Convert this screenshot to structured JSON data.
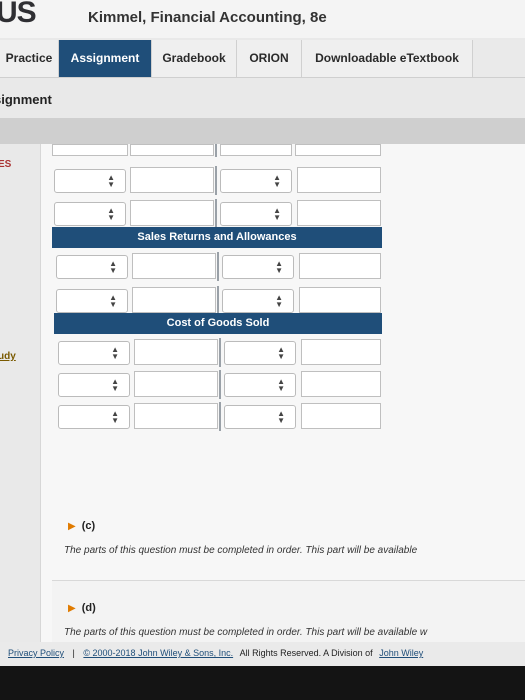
{
  "header": {
    "logo": "US",
    "book_title": "Kimmel, Financial Accounting, 8e"
  },
  "nav": {
    "tabs": [
      {
        "label": "Practice",
        "active": false
      },
      {
        "label": "Assignment",
        "active": true
      },
      {
        "label": "Gradebook",
        "active": false
      },
      {
        "label": "ORION",
        "active": false
      },
      {
        "label": "Downloadable eTextbook",
        "active": false
      }
    ]
  },
  "page": {
    "heading": "signment",
    "left_labels": [
      "ES",
      "udy"
    ]
  },
  "ledger": {
    "accounts": [
      {
        "title": "Sales Returns and Allowances"
      },
      {
        "title": "Cost of Goods Sold"
      }
    ]
  },
  "parts": [
    {
      "label": "(c)",
      "note": "The parts of this question must be completed in order. This part will be available"
    },
    {
      "label": "(d)",
      "note": "The parts of this question must be completed in order. This part will be available w"
    }
  ],
  "footer": {
    "privacy": "Privacy Policy",
    "separator": "|",
    "copyright_link": "© 2000-2018 John Wiley & Sons, Inc.",
    "rights_text": "All Rights Reserved. A Division of",
    "company_link": "John Wiley"
  },
  "colors": {
    "accent": "#1f4e79",
    "tab_active_text": "#ffffff"
  }
}
